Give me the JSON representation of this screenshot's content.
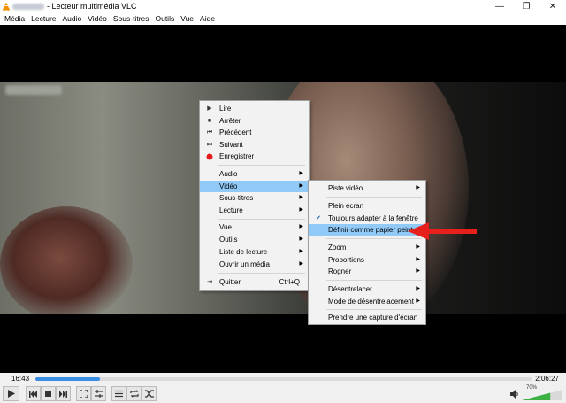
{
  "window": {
    "title": "- Lecteur multimédia VLC",
    "minimize_glyph": "—",
    "restore_glyph": "❐",
    "close_glyph": "✕"
  },
  "menubar": [
    "Média",
    "Lecture",
    "Audio",
    "Vidéo",
    "Sous-titres",
    "Outils",
    "Vue",
    "Aide"
  ],
  "context_menu": {
    "items": [
      {
        "label": "Lire",
        "icon": "play-icon"
      },
      {
        "label": "Arrêter",
        "icon": "stop-icon"
      },
      {
        "label": "Précédent",
        "icon": "previous-icon"
      },
      {
        "label": "Suivant",
        "icon": "next-icon"
      },
      {
        "label": "Enregistrer",
        "icon": "record-icon"
      },
      {
        "label": "Audio",
        "submenu": true
      },
      {
        "label": "Vidéo",
        "submenu": true,
        "highlighted": true
      },
      {
        "label": "Sous-titres",
        "submenu": true
      },
      {
        "label": "Lecture",
        "submenu": true
      },
      {
        "label": "Vue",
        "submenu": true
      },
      {
        "label": "Outils",
        "submenu": true
      },
      {
        "label": "Liste de lecture",
        "submenu": true
      },
      {
        "label": "Ouvrir un média",
        "submenu": true
      },
      {
        "label": "Quitter",
        "shortcut": "Ctrl+Q",
        "icon": "quit-icon"
      }
    ]
  },
  "video_submenu": {
    "items": [
      {
        "label": "Piste vidéo",
        "submenu": true
      },
      {
        "label": "Plein écran"
      },
      {
        "label": "Toujours adapter à la fenêtre",
        "checked": true
      },
      {
        "label": "Définir comme papier peint",
        "highlighted": true
      },
      {
        "label": "Zoom",
        "submenu": true
      },
      {
        "label": "Proportions",
        "submenu": true
      },
      {
        "label": "Rogner",
        "submenu": true
      },
      {
        "label": "Désentrelacer",
        "submenu": true
      },
      {
        "label": "Mode de désentrelacement",
        "submenu": true
      },
      {
        "label": "Prendre une capture d'écran"
      }
    ]
  },
  "playback": {
    "current_time": "16:43",
    "total_time": "2:06:27",
    "progress_fraction": 0.13
  },
  "volume": {
    "percent_label": "70%",
    "level": 0.7
  },
  "colors": {
    "highlight": "#91c9f7",
    "seek_fill": "#3a8ee6",
    "volume_fill": "#3cb043",
    "record_dot": "#e31b1b",
    "annotation_arrow": "#e8201c"
  }
}
